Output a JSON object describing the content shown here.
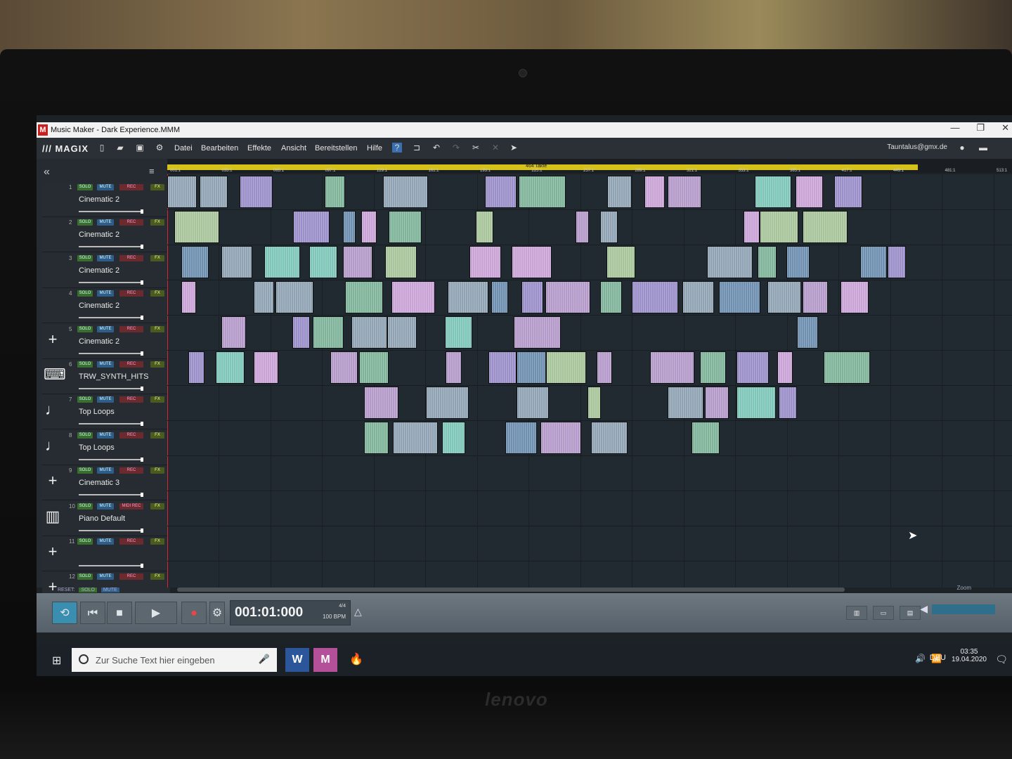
{
  "window": {
    "title": "Music Maker - Dark Experience.MMM",
    "controls": [
      "—",
      "❐",
      "✕"
    ]
  },
  "menubar": {
    "logo": "MAGIX",
    "items": [
      "Datei",
      "Bearbeiten",
      "Effekte",
      "Ansicht",
      "Bereitstellen",
      "Hilfe"
    ],
    "user": "Tauntalus@gmx.de"
  },
  "ruler": {
    "range_label": "464 Takte",
    "ticks": [
      "001:1",
      "033:1",
      "065:1",
      "097:1",
      "129:1",
      "161:1",
      "193:1",
      "225:1",
      "257:1",
      "289:1",
      "321:1",
      "353:1",
      "385:1",
      "417:1",
      "449:1",
      "481:1",
      "513:1"
    ]
  },
  "tracks": [
    {
      "num": "1",
      "name": "Cinematic 2",
      "icon": "blank",
      "rec": "REC"
    },
    {
      "num": "2",
      "name": "Cinematic 2",
      "icon": "blank",
      "rec": "REC"
    },
    {
      "num": "3",
      "name": "Cinematic 2",
      "icon": "blank",
      "rec": "REC"
    },
    {
      "num": "4",
      "name": "Cinematic 2",
      "icon": "blank",
      "rec": "REC"
    },
    {
      "num": "5",
      "name": "Cinematic 2",
      "icon": "plus-icon",
      "rec": "REC"
    },
    {
      "num": "6",
      "name": "TRW_SYNTH_HITS",
      "icon": "keyboard-icon",
      "rec": "REC"
    },
    {
      "num": "7",
      "name": "Top Loops",
      "icon": "note-icon",
      "rec": "REC"
    },
    {
      "num": "8",
      "name": "Top Loops",
      "icon": "note-icon",
      "rec": "REC"
    },
    {
      "num": "9",
      "name": "Cinematic 3",
      "icon": "plus-icon",
      "rec": "REC"
    },
    {
      "num": "10",
      "name": "Piano Default",
      "icon": "piano-icon",
      "rec": "MIDI REC"
    },
    {
      "num": "11",
      "name": "",
      "icon": "plus-icon",
      "rec": "REC"
    },
    {
      "num": "12",
      "name": "",
      "icon": "plus-icon",
      "rec": "REC"
    }
  ],
  "track_buttons": {
    "solo": "SOLO",
    "mute": "MUTE",
    "fx": "FX"
  },
  "reset_row": {
    "reset": "RESET:",
    "solo": "SOLO",
    "mute": "MUTE"
  },
  "zoom_label": "Zoom",
  "transport": {
    "position": "001:01:000",
    "time_signature": "4/4",
    "bpm": "100 BPM"
  },
  "taskbar": {
    "search_placeholder": "Zur Suche Text hier eingeben",
    "apps": [
      "W",
      "M",
      "🔥"
    ],
    "language": "DEU",
    "time": "03:35",
    "date": "19.04.2020"
  },
  "colors": {
    "accent_yellow": "#d4c21a",
    "playhead": "#dd2233",
    "loop_active": "#3a8fb0"
  }
}
